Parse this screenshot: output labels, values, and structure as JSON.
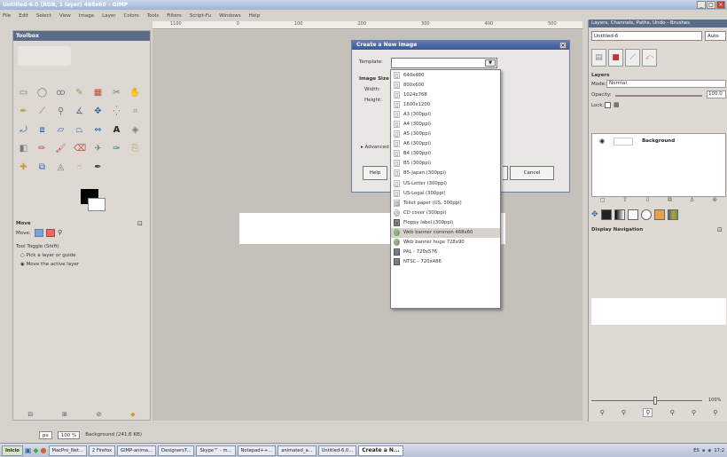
{
  "window": {
    "title": "Untitled-6.0 (RGB, 1 layer) 468x60 – GIMP"
  },
  "menu": [
    "File",
    "Edit",
    "Select",
    "View",
    "Image",
    "Layer",
    "Colors",
    "Tools",
    "Filters",
    "Script-Fu",
    "Windows",
    "Help"
  ],
  "toolbox": {
    "title": "Toolbox",
    "options": {
      "title": "Move",
      "move_label": "Move:",
      "toggle_label": "Tool Toggle (Shift)",
      "option_1": "Pick a layer or guide",
      "option_2": "Move the active layer"
    }
  },
  "ruler": [
    "1100",
    "0",
    "100",
    "200",
    "300",
    "400",
    "500"
  ],
  "status": {
    "unit": "px",
    "zoom": "100 %",
    "info": "Background (241,6 KB)"
  },
  "dialog": {
    "title": "Create a New Image",
    "template_label": "Template:",
    "image_size_label": "Image Size",
    "width_label": "Width:",
    "height_label": "Height:",
    "advanced_label": "Advanced Options",
    "help_label": "Help",
    "cancel_label": "Cancel"
  },
  "dropdown": {
    "items": [
      {
        "label": "640x480",
        "icon": "page-icon"
      },
      {
        "label": "800x600",
        "icon": "page-icon"
      },
      {
        "label": "1024x768",
        "icon": "page-icon"
      },
      {
        "label": "1600x1200",
        "icon": "page-icon"
      },
      {
        "label": "A3 (300ppi)",
        "icon": "page-icon"
      },
      {
        "label": "A4 (300ppi)",
        "icon": "page-icon"
      },
      {
        "label": "A5 (300ppi)",
        "icon": "page-icon"
      },
      {
        "label": "A6 (300ppi)",
        "icon": "page-icon"
      },
      {
        "label": "B4 (300ppi)",
        "icon": "page-icon"
      },
      {
        "label": "B5 (300ppi)",
        "icon": "page-icon"
      },
      {
        "label": "B5-Japan (300ppi)",
        "icon": "page-icon"
      },
      {
        "label": "US-Letter (300ppi)",
        "icon": "page-icon"
      },
      {
        "label": "US-Legal (300ppi)",
        "icon": "page-icon"
      },
      {
        "label": "Toilet paper (US, 300ppi)",
        "icon": "roll-icon"
      },
      {
        "label": "CD cover (300ppi)",
        "icon": "cd-icon"
      },
      {
        "label": "Floppy label (300ppi)",
        "icon": "floppy-icon"
      },
      {
        "label": "Web banner common 468x60",
        "icon": "globe-icon",
        "selected": true
      },
      {
        "label": "Web banner huge 728x90",
        "icon": "globe-icon"
      },
      {
        "label": "PAL - 720x576",
        "icon": "film-icon"
      },
      {
        "label": "NTSC - 720x486",
        "icon": "film-icon"
      }
    ]
  },
  "right_panel": {
    "title": "Layers, Channels, Paths, Undo - Brushes",
    "image_combo": "Untitled-6",
    "auto_label": "Auto",
    "layers_label": "Layers",
    "mode_label": "Mode:",
    "mode_value": "Normal",
    "opacity_label": "Opacity:",
    "opacity_value": "100.0",
    "lock_label": "Lock:",
    "layer_name": "Background",
    "nav_title": "Display Navigation",
    "zoom_value": "100%"
  },
  "taskbar": {
    "start": "Inicio",
    "items": [
      "MacPro_Net...",
      "2 Firefox",
      "GIMP-anima...",
      "DesignersT...",
      "Skype™ - m...",
      "Notepad++...",
      "animated_a...",
      "Untitled-6.0..."
    ],
    "active": "Create a N...",
    "lang": "ES",
    "time": "17:2"
  }
}
